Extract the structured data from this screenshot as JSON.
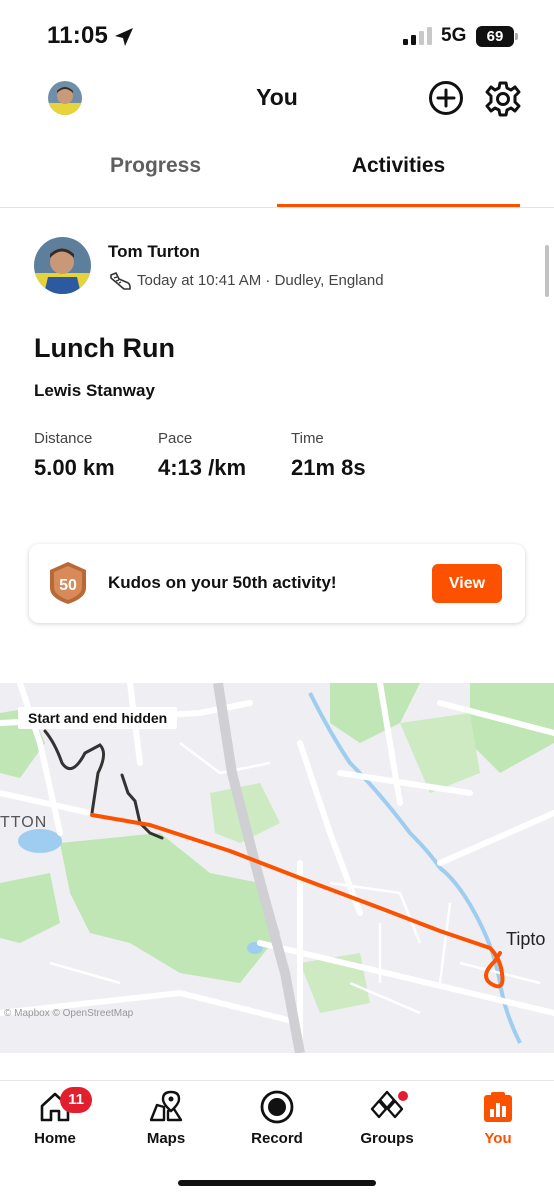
{
  "status_bar": {
    "time": "11:05",
    "network": "5G",
    "battery": "69"
  },
  "header": {
    "title": "You"
  },
  "tabs": [
    {
      "label": "Progress"
    },
    {
      "label": "Activities"
    }
  ],
  "activity": {
    "athlete_name": "Tom Turton",
    "meta": "Today at 10:41 AM · Dudley, England",
    "title": "Lunch Run",
    "description": "Lewis Stanway",
    "stats": [
      {
        "label": "Distance",
        "value": "5.00 km"
      },
      {
        "label": "Pace",
        "value": "4:13 /km"
      },
      {
        "label": "Time",
        "value": "21m 8s"
      }
    ]
  },
  "kudos": {
    "badge_number": "50",
    "text": "Kudos on your 50th activity!",
    "button_label": "View"
  },
  "map": {
    "hidden_label": "Start and end hidden",
    "place_left": "TTON",
    "place_right": "Tipto",
    "attribution": "© Mapbox © OpenStreetMap"
  },
  "tabbar": {
    "items": [
      {
        "label": "Home",
        "badge": "11"
      },
      {
        "label": "Maps"
      },
      {
        "label": "Record"
      },
      {
        "label": "Groups"
      },
      {
        "label": "You"
      }
    ]
  },
  "colors": {
    "accent": "#fc5200",
    "badge": "#e21f2d",
    "map_bg": "#eeeef3",
    "map_green": "#bfe6b4",
    "map_water": "#9fcdf0"
  }
}
